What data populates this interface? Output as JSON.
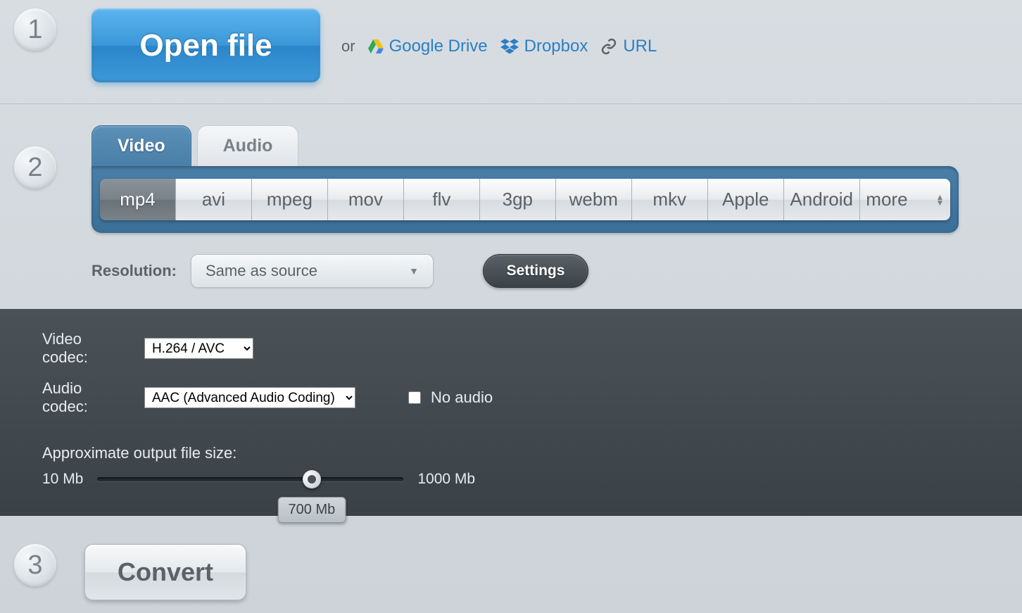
{
  "steps": {
    "one": "1",
    "two": "2",
    "three": "3"
  },
  "open_file": "Open file",
  "or": "or",
  "links": {
    "gdrive": "Google Drive",
    "dropbox": "Dropbox",
    "url": "URL"
  },
  "tabs": {
    "video": "Video",
    "audio": "Audio"
  },
  "formats": [
    "mp4",
    "avi",
    "mpeg",
    "mov",
    "flv",
    "3gp",
    "webm",
    "mkv",
    "Apple",
    "Android",
    "more"
  ],
  "resolution": {
    "label": "Resolution:",
    "value": "Same as source"
  },
  "settings_btn": "Settings",
  "video_codec": {
    "label": "Video codec:",
    "value": "H.264 / AVC"
  },
  "audio_codec": {
    "label": "Audio codec:",
    "value": "AAC (Advanced Audio Coding)"
  },
  "no_audio": "No audio",
  "size": {
    "label": "Approximate output file size:",
    "min": "10 Mb",
    "max": "1000 Mb",
    "value": "700 Mb"
  },
  "convert": "Convert"
}
